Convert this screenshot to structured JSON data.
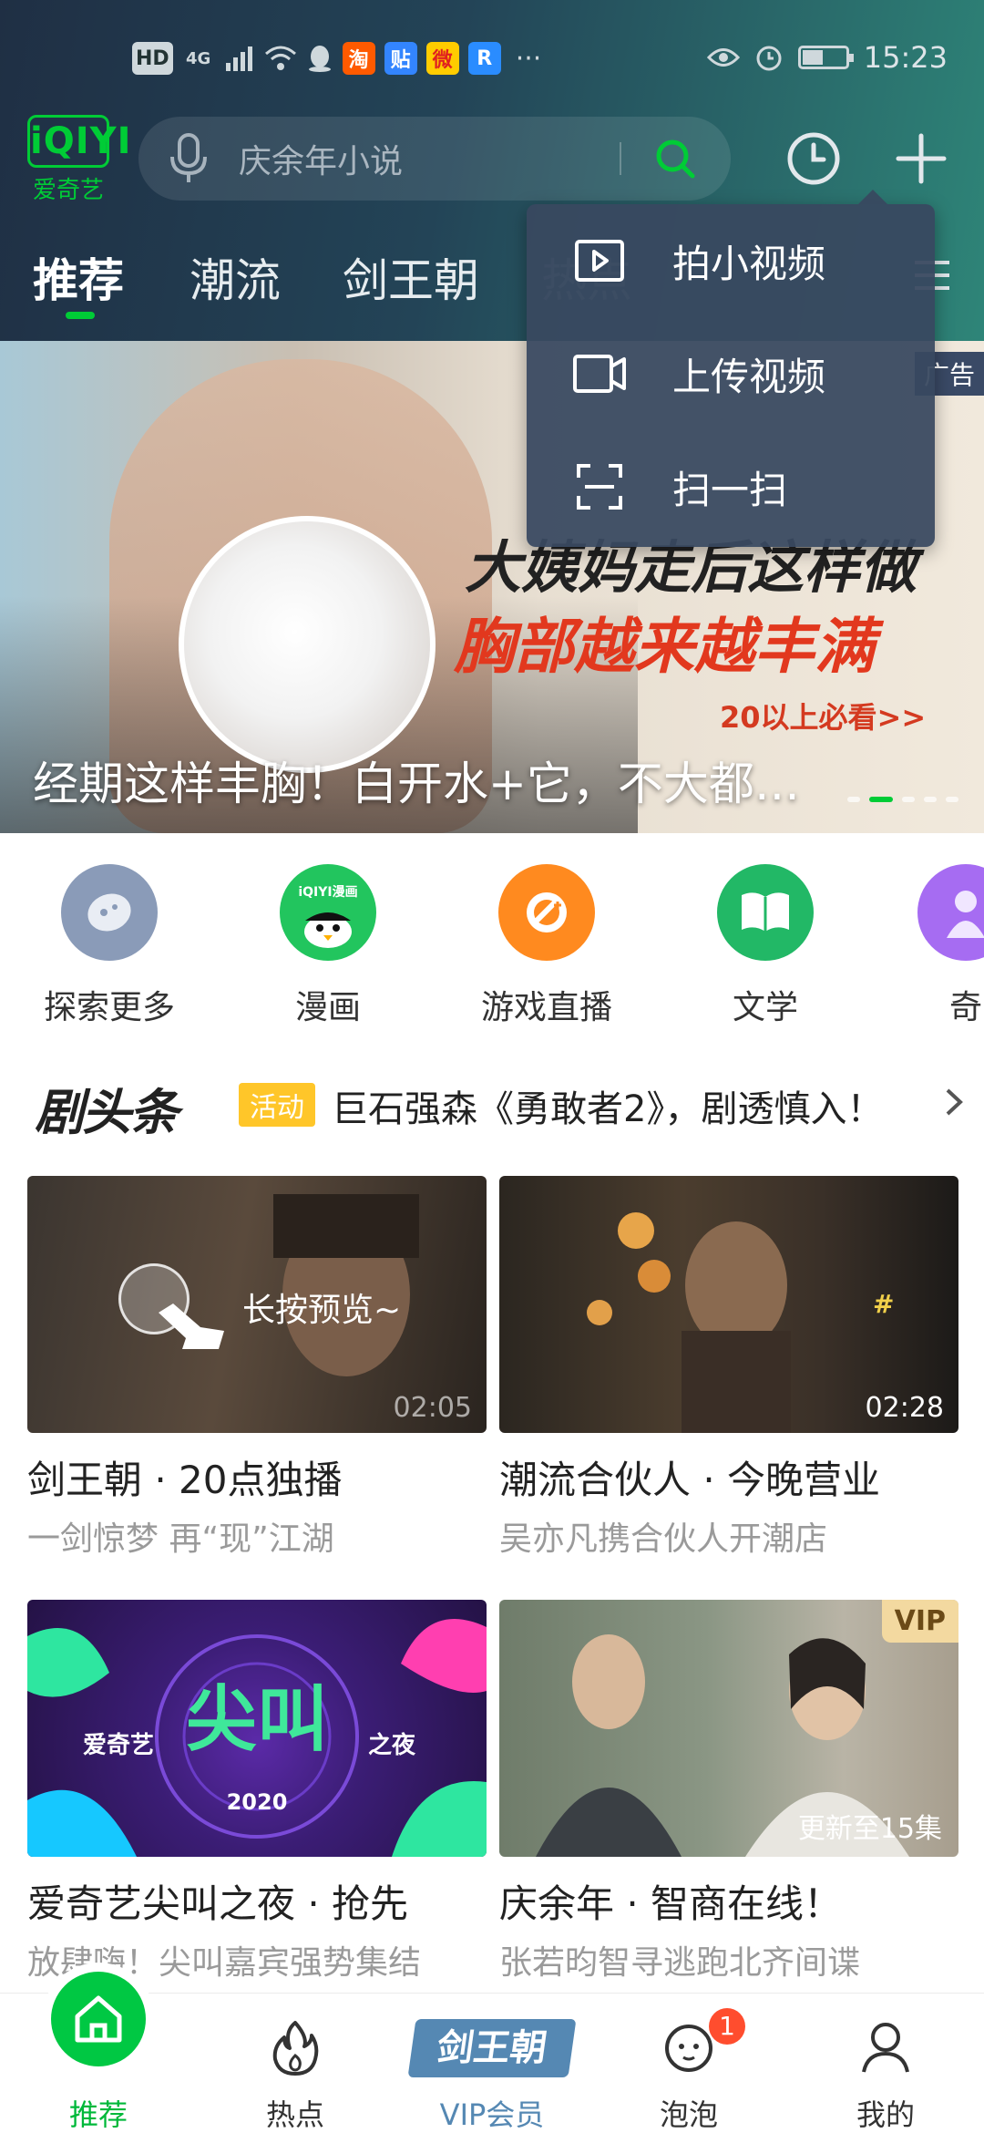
{
  "status_bar": {
    "left_chips": [
      "HD",
      "4G",
      "淘",
      "贴",
      "微",
      "R"
    ],
    "more": "···",
    "time": "15:23"
  },
  "header": {
    "logo_mark": "iQIYI",
    "logo_text": "爱奇艺",
    "search_placeholder": "庆余年小说",
    "tabs": [
      {
        "label": "推荐"
      },
      {
        "label": "潮流"
      },
      {
        "label": "剑王朝"
      },
      {
        "label": "热点"
      }
    ],
    "accent_color": "#00cc36"
  },
  "dropdown": {
    "items": [
      {
        "label": "拍小视频",
        "icon": "play-icon"
      },
      {
        "label": "上传视频",
        "icon": "camera-icon"
      },
      {
        "label": "扫一扫",
        "icon": "scan-icon"
      }
    ]
  },
  "banner": {
    "headline_line1": "大姨妈走后这样做",
    "headline_line2": "胸部越来越丰满",
    "sub": "20以上必看>>",
    "ad_tag": "广告",
    "title": "经期这样丰胸！白开水+它，不大都…"
  },
  "quick_icons": [
    {
      "label": "探索更多",
      "color": "#8a9bb8"
    },
    {
      "label": "漫画",
      "color": "#22c55e",
      "mark": "iQIYI漫画"
    },
    {
      "label": "游戏直播",
      "color": "#ff8a1f"
    },
    {
      "label": "文学",
      "color": "#22b866"
    },
    {
      "label": "奇",
      "color": "#a66cf2"
    }
  ],
  "headline": {
    "logo": "剧头条",
    "badge": "活动",
    "text": "巨石强森《勇敢者2》，剧透慎入！"
  },
  "cards": [
    {
      "title": "剑王朝 · 20点独播",
      "sub": "一剑惊梦 再“现”江湖",
      "duration": "02:05",
      "hint": "长按预览~"
    },
    {
      "title": "潮流合伙人 · 今晚营业",
      "sub": "吴亦凡携合伙人开潮店",
      "duration": "02:28"
    },
    {
      "title": "爱奇艺尖叫之夜 · 抢先",
      "sub": "放肆嗨！尖叫嘉宾强势集结",
      "thumb_text": "爱奇艺 尖叫 之夜 2020"
    },
    {
      "title": "庆余年 · 智商在线！",
      "sub": "张若昀智寻逃跑北齐间谍",
      "vip": "VIP",
      "update": "更新至15集"
    }
  ],
  "bottom_nav": [
    {
      "label": "推荐",
      "icon": "home-icon",
      "active": true
    },
    {
      "label": "热点",
      "icon": "flame-icon"
    },
    {
      "label": "VIP会员",
      "icon": "vip-logo",
      "logo_text": "剑王朝"
    },
    {
      "label": "泡泡",
      "icon": "bubble-face-icon",
      "badge": "1"
    },
    {
      "label": "我的",
      "icon": "profile-icon"
    }
  ]
}
